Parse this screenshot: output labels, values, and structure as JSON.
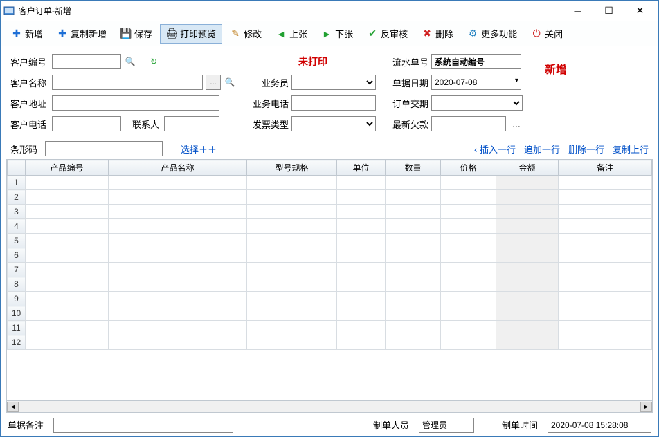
{
  "window": {
    "title": "客户订单-新增"
  },
  "toolbar": {
    "new": "新增",
    "copy_new": "复制新增",
    "save": "保存",
    "print_preview": "打印预览",
    "modify": "修改",
    "prev": "上张",
    "next": "下张",
    "unaudit": "反审核",
    "delete": "删除",
    "more": "更多功能",
    "close": "关闭"
  },
  "form": {
    "customer_no_label": "客户编号",
    "customer_no": "",
    "customer_name_label": "客户名称",
    "customer_name": "",
    "customer_addr_label": "客户地址",
    "customer_addr": "",
    "customer_tel_label": "客户电话",
    "customer_tel": "",
    "contact_label": "联系人",
    "contact": "",
    "print_status": "未打印",
    "salesman_label": "业务员",
    "salesman": "",
    "sales_tel_label": "业务电话",
    "sales_tel": "",
    "invoice_type_label": "发票类型",
    "invoice_type": "",
    "serial_label": "流水单号",
    "serial_value": "系统自动编号",
    "doc_date_label": "单据日期",
    "doc_date": "2020-07-08",
    "order_due_label": "订单交期",
    "order_due": "",
    "latest_debt_label": "最新欠款",
    "latest_debt": "",
    "status_badge": "新增"
  },
  "grid_toolbar": {
    "barcode_label": "条形码",
    "barcode": "",
    "select_plus": "选择＋＋",
    "insert_row": "插入一行",
    "append_row": "追加一行",
    "delete_row": "删除一行",
    "copy_row": "复制上行",
    "insert_arrow": "‹"
  },
  "grid": {
    "headers": [
      "产品编号",
      "产品名称",
      "型号规格",
      "单位",
      "数量",
      "价格",
      "金额",
      "备注"
    ],
    "rows": 12
  },
  "footer": {
    "remark_label": "单据备注",
    "remark": "",
    "creator_label": "制单人员",
    "creator": "管理员",
    "create_time_label": "制单时间",
    "create_time": "2020-07-08 15:28:08"
  },
  "icons": {
    "search": "🔍",
    "refresh": "↻",
    "dots": "...",
    "plus": "✚",
    "save": "💾",
    "printer": "🖨",
    "edit": "✎",
    "prev": "◄",
    "next": "►",
    "check": "✔",
    "delete": "✖",
    "gear": "⚙",
    "power": "⏻",
    "dropdown": "▾"
  },
  "colors": {
    "accent_red": "#d00000",
    "link_blue": "#0050c8"
  }
}
